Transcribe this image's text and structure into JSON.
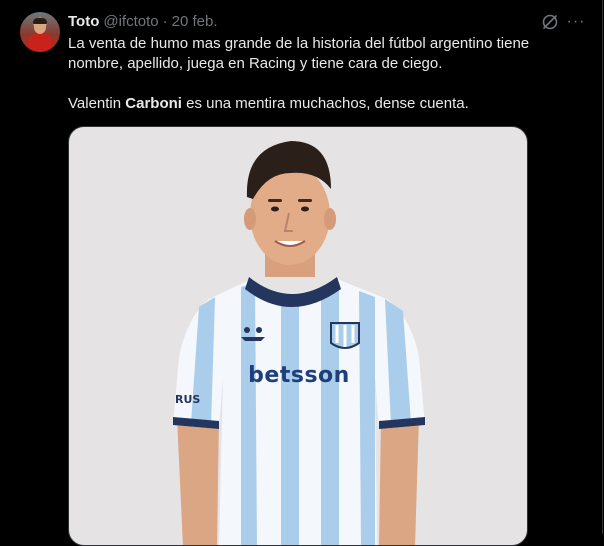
{
  "tweet": {
    "author_name": "Toto",
    "handle": "@ifctoto",
    "separator": "·",
    "date": "20 feb.",
    "text_line1": "La venta de humo mas grande de la historia del fútbol argentino tiene nombre, apellido, juega en Racing y tiene cara de ciego.",
    "text_line2_pre": "Valentin ",
    "text_line2_bold": "Carboni",
    "text_line2_post": " es una mentira muchachos, dense cuenta.",
    "more_label": "···"
  },
  "media": {
    "shirt_sponsor": "betsson",
    "shirt_brand": "Kappa",
    "sleeve_text": "RUS"
  },
  "icons": [
    "grok-icon",
    "more-icon"
  ],
  "colors": {
    "background": "#000000",
    "text": "#e7e9ea",
    "muted": "#71767b",
    "media_bg": "#e5e3e4",
    "jersey_light": "#a9cdea",
    "jersey_navy": "#24365e"
  }
}
